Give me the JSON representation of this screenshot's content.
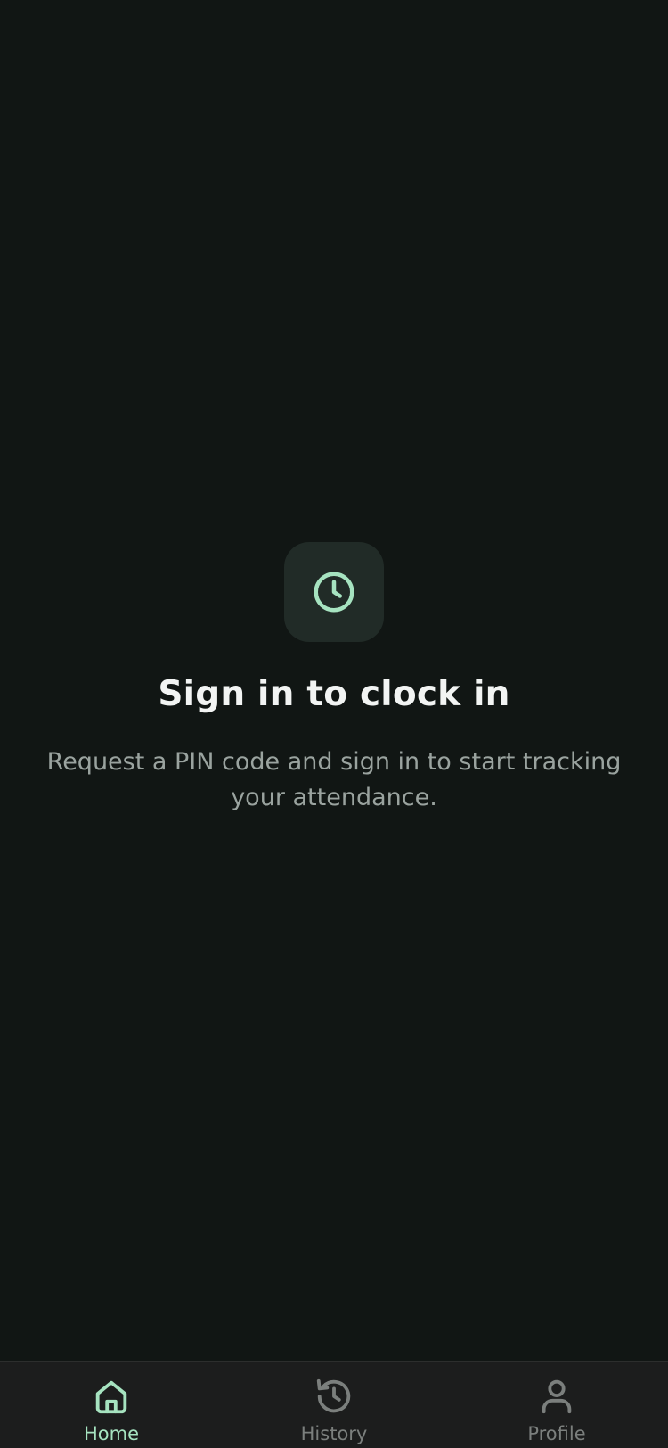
{
  "empty_state": {
    "icon": "clock-icon",
    "title": "Sign in to clock in",
    "subtitle": "Request a PIN code and sign in to start tracking your attendance."
  },
  "tabbar": {
    "active": "Home",
    "items": [
      {
        "label": "Home",
        "icon": "home-icon"
      },
      {
        "label": "History",
        "icon": "history-icon"
      },
      {
        "label": "Profile",
        "icon": "profile-icon"
      }
    ]
  },
  "colors": {
    "background": "#111614",
    "accent": "#a6e3c0",
    "icon_tile": "#212b27",
    "tabbar": "#1c1d1d",
    "inactive": "#7b7f7d",
    "subtitle": "#9aa39f"
  }
}
